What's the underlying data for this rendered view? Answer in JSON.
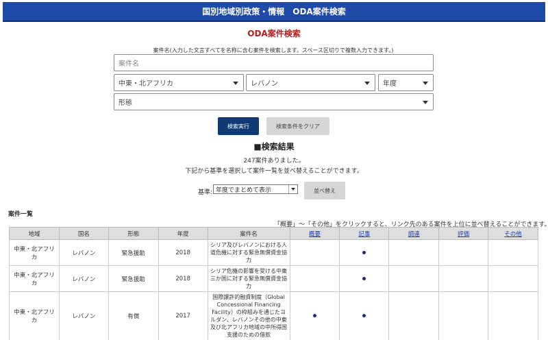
{
  "header": {
    "title": "国別地域別政策・情報　ODA案件検索"
  },
  "search": {
    "title": "ODA案件検索",
    "hint": "案件名(入力した文言すべてを名称に含む案件を検索します。スペース区切りで複数入力できます。)",
    "name_placeholder": "案件名",
    "region_value": "中東・北アフリカ",
    "country_value": "レバノン",
    "year_value": "年度",
    "form_value": "形態",
    "run_label": "検索実行",
    "clear_label": "検索条件をクリア"
  },
  "results": {
    "heading": "■検索結果",
    "count_text": "247案件ありました。",
    "sort_hint": "下記から基準を選択して案件一覧を並べ替えることができます。",
    "sort_label": "基準:",
    "sort_value": "年度でまとめて表示",
    "sort_button": "並べ替え"
  },
  "list": {
    "title": "案件一覧",
    "hint": "「概要」〜「その他」をクリックすると、リンク先のある案件を上位に並べ替えることができます。",
    "columns": [
      "地域",
      "国名",
      "形態",
      "年度",
      "案件名",
      "概要",
      "記事",
      "調達",
      "評価",
      "その他"
    ],
    "rows": [
      {
        "region": "中東・北アフリカ",
        "country": "レバノン",
        "form": "緊急援助",
        "year": "2018",
        "name": "シリア及びレバノンにおける人道危機に対する緊急無償資金協力"
      },
      {
        "region": "中東・北アフリカ",
        "country": "レバノン",
        "form": "緊急援助",
        "year": "2018",
        "name": "シリア危機の影響を受ける中東三か国に対する緊急無償資金協力"
      },
      {
        "region": "中東・北アフリカ",
        "country": "レバノン",
        "form": "有償",
        "year": "2017",
        "name": "国際譲許的融資制度（Global Concessional Financing Facility）の枠組みを通じたヨルダン、レバノンその他の中東及び北アフリカ地域の中所得国支援のための借款"
      }
    ]
  }
}
